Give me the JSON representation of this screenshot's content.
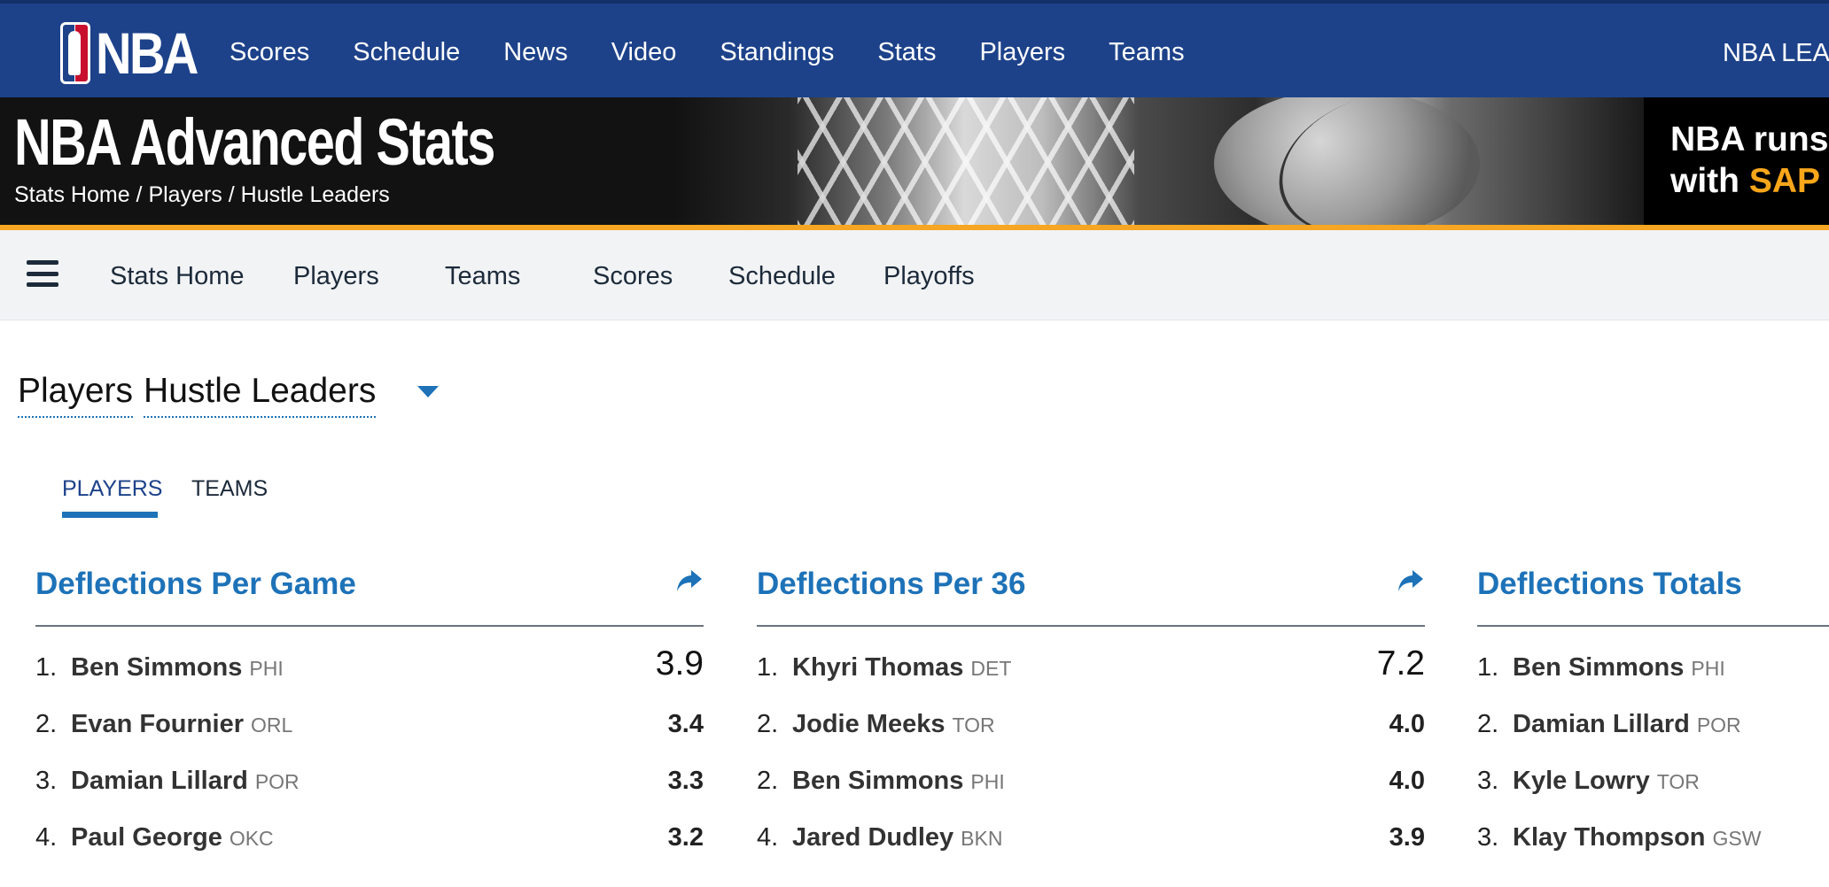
{
  "topnav": {
    "logo_text": "NBA",
    "links": [
      "Scores",
      "Schedule",
      "News",
      "Video",
      "Standings",
      "Stats",
      "Players",
      "Teams"
    ],
    "right_text": "NBA LEA"
  },
  "hero": {
    "title": "NBA Advanced Stats",
    "breadcrumb": "Stats Home / Players / Hustle Leaders",
    "sponsor_line1": "NBA runs",
    "sponsor_line2_prefix": "with",
    "sponsor_brand": "SAP"
  },
  "subnav": {
    "items": [
      "Stats Home",
      "Players",
      "Teams",
      "Scores",
      "Schedule",
      "Playoffs"
    ]
  },
  "page": {
    "title_part1": "Players",
    "title_part2": "Hustle Leaders"
  },
  "tabs": {
    "players": "PLAYERS",
    "teams": "TEAMS"
  },
  "columns": [
    {
      "title": "Deflections Per Game",
      "rows": [
        {
          "rank": "1.",
          "name": "Ben Simmons",
          "team": "PHI",
          "value": "3.9"
        },
        {
          "rank": "2.",
          "name": "Evan Fournier",
          "team": "ORL",
          "value": "3.4"
        },
        {
          "rank": "3.",
          "name": "Damian Lillard",
          "team": "POR",
          "value": "3.3"
        },
        {
          "rank": "4.",
          "name": "Paul George",
          "team": "OKC",
          "value": "3.2"
        }
      ]
    },
    {
      "title": "Deflections Per 36",
      "rows": [
        {
          "rank": "1.",
          "name": "Khyri Thomas",
          "team": "DET",
          "value": "7.2"
        },
        {
          "rank": "2.",
          "name": "Jodie Meeks",
          "team": "TOR",
          "value": "4.0"
        },
        {
          "rank": "2.",
          "name": "Ben Simmons",
          "team": "PHI",
          "value": "4.0"
        },
        {
          "rank": "4.",
          "name": "Jared Dudley",
          "team": "BKN",
          "value": "3.9"
        }
      ]
    },
    {
      "title": "Deflections Totals",
      "rows": [
        {
          "rank": "1.",
          "name": "Ben Simmons",
          "team": "PHI",
          "value": ""
        },
        {
          "rank": "2.",
          "name": "Damian Lillard",
          "team": "POR",
          "value": ""
        },
        {
          "rank": "3.",
          "name": "Kyle Lowry",
          "team": "TOR",
          "value": ""
        },
        {
          "rank": "3.",
          "name": "Klay Thompson",
          "team": "GSW",
          "value": ""
        }
      ]
    }
  ]
}
